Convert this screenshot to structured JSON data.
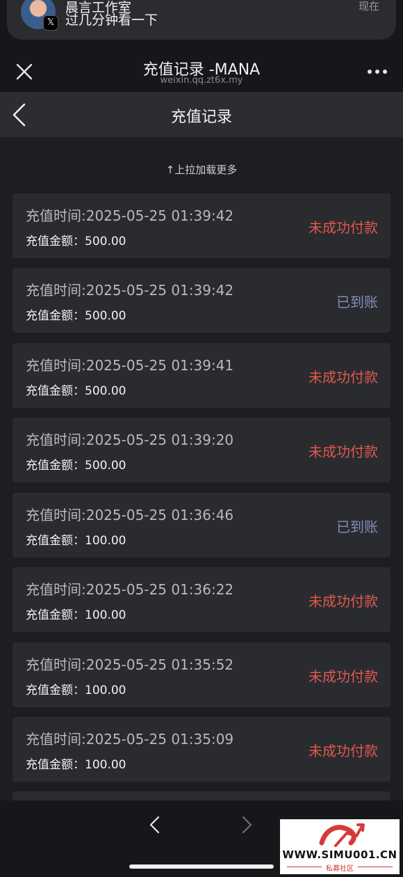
{
  "notification": {
    "title": "晨言工作室",
    "body": "过几分钟看一下",
    "time": "现在",
    "badge": "𝕏"
  },
  "browser": {
    "title": "充值记录 -MANA",
    "url": "weixin.qq.zt6x.my"
  },
  "nav": {
    "title": "充值记录"
  },
  "list": {
    "pull_hint": "↑上拉加载更多",
    "records": [
      {
        "time": "充值时间:2025-05-25 01:39:42",
        "amount_label": "充值金额：",
        "amount": "500.00",
        "status": "未成功付款",
        "status_color": "#e0584f"
      },
      {
        "time": "充值时间:2025-05-25 01:39:42",
        "amount_label": "充值金额：",
        "amount": "500.00",
        "status": "已到账",
        "status_color": "#7f8fb3"
      },
      {
        "time": "充值时间:2025-05-25 01:39:41",
        "amount_label": "充值金额：",
        "amount": "500.00",
        "status": "未成功付款",
        "status_color": "#e0584f"
      },
      {
        "time": "充值时间:2025-05-25 01:39:20",
        "amount_label": "充值金额：",
        "amount": "500.00",
        "status": "未成功付款",
        "status_color": "#e0584f"
      },
      {
        "time": "充值时间:2025-05-25 01:36:46",
        "amount_label": "充值金额：",
        "amount": "100.00",
        "status": "已到账",
        "status_color": "#7f8fb3"
      },
      {
        "time": "充值时间:2025-05-25 01:36:22",
        "amount_label": "充值金额：",
        "amount": "100.00",
        "status": "未成功付款",
        "status_color": "#e0584f"
      },
      {
        "time": "充值时间:2025-05-25 01:35:52",
        "amount_label": "充值金额：",
        "amount": "100.00",
        "status": "未成功付款",
        "status_color": "#e0584f"
      },
      {
        "time": "充值时间:2025-05-25 01:35:09",
        "amount_label": "充值金额：",
        "amount": "100.00",
        "status": "未成功付款",
        "status_color": "#e0584f"
      }
    ]
  },
  "watermark": {
    "text": "WWW.SIMU001.CN",
    "sub": "私募社区"
  },
  "icons": {
    "close": "close-icon",
    "more": "more-icon",
    "back": "chevron-left-icon",
    "browser_back": "chevron-left-icon",
    "browser_forward": "chevron-right-icon"
  }
}
